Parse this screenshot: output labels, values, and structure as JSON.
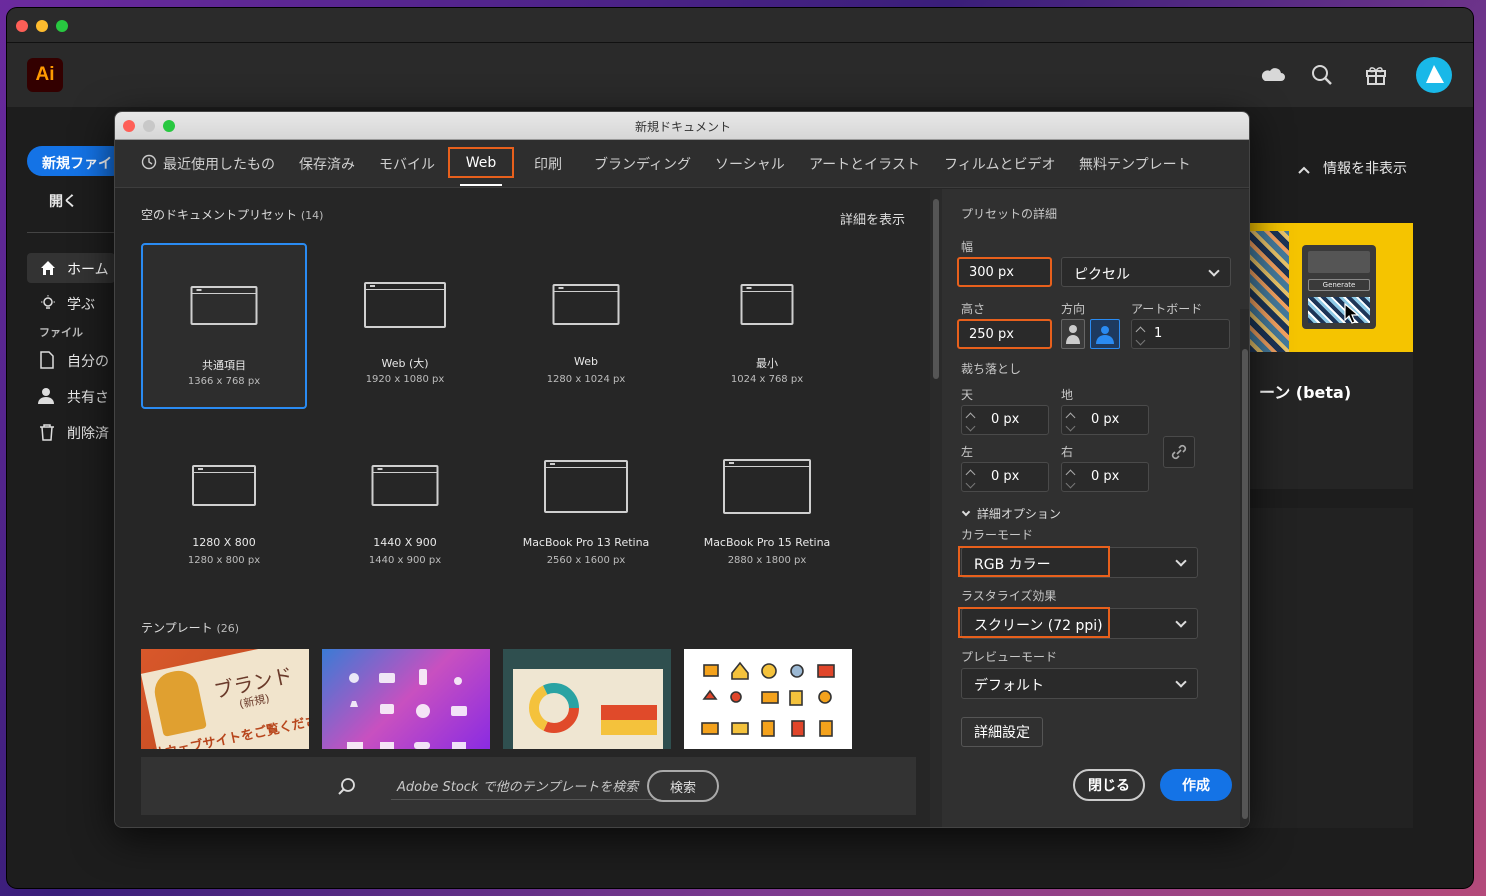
{
  "app": {
    "logo": "Ai",
    "new_file": "新規ファイ",
    "open": "開く",
    "home": "ホーム",
    "learn": "学ぶ",
    "file_header": "ファイル",
    "your_files": "自分の",
    "shared": "共有さ",
    "deleted": "削除済",
    "hide_info": "情報を非表示",
    "promo_title": "ーン (beta)",
    "promo_generate": "Generate"
  },
  "dialog": {
    "title": "新規ドキュメント",
    "tabs": [
      "最近使用したもの",
      "保存済み",
      "モバイル",
      "Web",
      "印刷",
      "ブランディング",
      "ソーシャル",
      "アートとイラスト",
      "フィルムとビデオ",
      "無料テンプレート"
    ],
    "active_tab": "Web",
    "presets_header": "空のドキュメントプリセット",
    "presets_count": "(14)",
    "show_details": "詳細を表示",
    "presets": [
      {
        "name": "共通項目",
        "size": "1366 x 768 px",
        "selected": true
      },
      {
        "name": "Web (大)",
        "size": "1920 x 1080 px"
      },
      {
        "name": "Web",
        "size": "1280 x 1024 px"
      },
      {
        "name": "最小",
        "size": "1024 x 768 px"
      },
      {
        "name": "1280 X 800",
        "size": "1280 x 800 px"
      },
      {
        "name": "1440 X 900",
        "size": "1440 x 900 px"
      },
      {
        "name": "MacBook Pro 13 Retina",
        "size": "2560 x 1600 px"
      },
      {
        "name": "MacBook Pro 15 Retina",
        "size": "2880 x 1800 px"
      }
    ],
    "templates_header": "テンプレート",
    "templates_count": "(26)",
    "template_text": {
      "brand": "ブランド",
      "new": "(新規)",
      "site": "当社ウェブサイトをご覧ください"
    },
    "search_placeholder": "Adobe Stock で他のテンプレートを検索",
    "search_button": "検索"
  },
  "details": {
    "header": "プリセットの詳細",
    "width_label": "幅",
    "width": "300 px",
    "unit": "ピクセル",
    "height_label": "高さ",
    "height": "250 px",
    "orientation_label": "方向",
    "artboard_label": "アートボード",
    "artboards": "1",
    "bleed_label": "裁ち落とし",
    "top_label": "天",
    "top": "0 px",
    "bottom_label": "地",
    "bottom": "0 px",
    "left_label": "左",
    "left": "0 px",
    "right_label": "右",
    "right": "0 px",
    "advanced_options": "詳細オプション",
    "color_mode_label": "カラーモード",
    "color_mode": "RGB カラー",
    "raster_label": "ラスタライズ効果",
    "raster": "スクリーン (72 ppi)",
    "preview_label": "プレビューモード",
    "preview": "デフォルト",
    "advanced_settings": "詳細設定",
    "close": "閉じる",
    "create": "作成"
  },
  "colors": {
    "accent": "#1473e6",
    "highlight": "#e8601c",
    "selection": "#2a8bf2"
  }
}
